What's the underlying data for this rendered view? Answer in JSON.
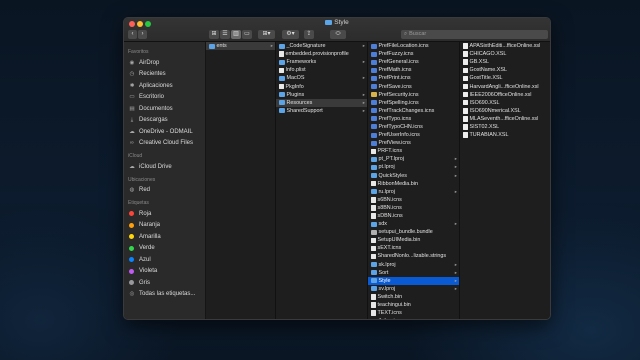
{
  "window": {
    "title": "Style"
  },
  "toolbar": {
    "back_icon": "chevron-left-icon",
    "forward_icon": "chevron-right-icon",
    "search_placeholder": "Buscar"
  },
  "sidebar": {
    "favorites_header": "Favoritos",
    "favorites": [
      {
        "label": "AirDrop",
        "icon": "airdrop-icon"
      },
      {
        "label": "Recientes",
        "icon": "clock-icon"
      },
      {
        "label": "Aplicaciones",
        "icon": "applications-icon"
      },
      {
        "label": "Escritorio",
        "icon": "desktop-icon"
      },
      {
        "label": "Documentos",
        "icon": "document-icon"
      },
      {
        "label": "Descargas",
        "icon": "download-icon"
      },
      {
        "label": "OneDrive - ODMAIL",
        "icon": "cloud-icon"
      },
      {
        "label": "Creative Cloud Files",
        "icon": "creative-cloud-icon"
      }
    ],
    "icloud_header": "iCloud",
    "icloud": [
      {
        "label": "iCloud Drive",
        "icon": "cloud-icon"
      }
    ],
    "locations_header": "Ubicaciones",
    "locations": [
      {
        "label": "Red",
        "icon": "network-icon"
      }
    ],
    "tags_header": "Etiquetas",
    "tags": [
      {
        "label": "Roja",
        "color": "#ff453a"
      },
      {
        "label": "Naranja",
        "color": "#ff9f0a"
      },
      {
        "label": "Amarilla",
        "color": "#ffd60a"
      },
      {
        "label": "Verde",
        "color": "#32d74b"
      },
      {
        "label": "Azul",
        "color": "#0a84ff"
      },
      {
        "label": "Violeta",
        "color": "#bf5af2"
      },
      {
        "label": "Gris",
        "color": "#98989d"
      },
      {
        "label": "Todas las etiquetas...",
        "color": ""
      }
    ]
  },
  "columns": {
    "col1": [
      {
        "label": "ents",
        "kind": "folder",
        "selected": "hl",
        "chevron": true
      }
    ],
    "col2": [
      {
        "label": "_CodeSignature",
        "kind": "folder",
        "chevron": true
      },
      {
        "label": "embedded.provisionprofile",
        "kind": "file"
      },
      {
        "label": "Frameworks",
        "kind": "folder",
        "chevron": true
      },
      {
        "label": "Info.plist",
        "kind": "file"
      },
      {
        "label": "MacOS",
        "kind": "folder",
        "chevron": true
      },
      {
        "label": "PkgInfo",
        "kind": "file"
      },
      {
        "label": "Plugins",
        "kind": "folder",
        "chevron": true
      },
      {
        "label": "Resources",
        "kind": "folder",
        "selected": "hl",
        "chevron": true
      },
      {
        "label": "SharedSupport",
        "kind": "folder",
        "chevron": true
      }
    ],
    "col3": [
      {
        "label": "PrefFileLocation.icns",
        "kind": "icns"
      },
      {
        "label": "PrefFuzzy.icns",
        "kind": "icns"
      },
      {
        "label": "PrefGeneral.icns",
        "kind": "icns"
      },
      {
        "label": "PrefMath.icns",
        "kind": "icns"
      },
      {
        "label": "PrefPrint.icns",
        "kind": "icns"
      },
      {
        "label": "PrefSave.icns",
        "kind": "icns"
      },
      {
        "label": "PrefSecurity.icns",
        "kind": "lock"
      },
      {
        "label": "PrefSpelling.icns",
        "kind": "icns"
      },
      {
        "label": "PrefTrackChanges.icns",
        "kind": "icns"
      },
      {
        "label": "PrefTypo.icns",
        "kind": "icns"
      },
      {
        "label": "PrefTypoCHN.icns",
        "kind": "icns"
      },
      {
        "label": "PrefUserInfo.icns",
        "kind": "icns"
      },
      {
        "label": "PrefView.icns",
        "kind": "icns"
      },
      {
        "label": "PRFT.icns",
        "kind": "file"
      },
      {
        "label": "pt_PT.lproj",
        "kind": "folder",
        "chevron": true
      },
      {
        "label": "pt.lproj",
        "kind": "folder",
        "chevron": true
      },
      {
        "label": "QuickStyles",
        "kind": "folder",
        "chevron": true
      },
      {
        "label": "RibbonMedia.bin",
        "kind": "file"
      },
      {
        "label": "ru.lproj",
        "kind": "folder",
        "chevron": true
      },
      {
        "label": "s6BN.icns",
        "kind": "file"
      },
      {
        "label": "s8BN.icns",
        "kind": "file"
      },
      {
        "label": "sDBN.icns",
        "kind": "file"
      },
      {
        "label": "sdx",
        "kind": "folder",
        "chevron": true
      },
      {
        "label": "setupui_bundle.bundle",
        "kind": "bundle"
      },
      {
        "label": "SetupUIMedia.bin",
        "kind": "file"
      },
      {
        "label": "sEXT.icns",
        "kind": "file"
      },
      {
        "label": "SharedNonlo...lizable.strings",
        "kind": "file"
      },
      {
        "label": "sk.lproj",
        "kind": "folder",
        "chevron": true
      },
      {
        "label": "Sort",
        "kind": "folder",
        "chevron": true
      },
      {
        "label": "Style",
        "kind": "folder",
        "selected": "sel",
        "chevron": true
      },
      {
        "label": "sv.lproj",
        "kind": "folder",
        "chevron": true
      },
      {
        "label": "Switch.bin",
        "kind": "file"
      },
      {
        "label": "teachingui.bin",
        "kind": "file"
      },
      {
        "label": "TEXT.icns",
        "kind": "file"
      },
      {
        "label": "th.lproj",
        "kind": "folder",
        "chevron": true
      }
    ],
    "col4": [
      {
        "label": "APASixthEditi...fficeOnline.xsl",
        "kind": "xsl"
      },
      {
        "label": "CHICAGO.XSL",
        "kind": "xsl"
      },
      {
        "label": "GB.XSL",
        "kind": "xsl"
      },
      {
        "label": "GostName.XSL",
        "kind": "xsl"
      },
      {
        "label": "GostTitle.XSL",
        "kind": "xsl"
      },
      {
        "label": "HarvardAngli...fficeOnline.xsl",
        "kind": "xsl"
      },
      {
        "label": "IEEE2006OfficeOnline.xsl",
        "kind": "xsl"
      },
      {
        "label": "ISO690.XSL",
        "kind": "xsl"
      },
      {
        "label": "ISO690Nmerical.XSL",
        "kind": "xsl"
      },
      {
        "label": "MLASeventh...fficeOnline.xsl",
        "kind": "xsl"
      },
      {
        "label": "SIST02.XSL",
        "kind": "xsl"
      },
      {
        "label": "TURABIAN.XSL",
        "kind": "xsl"
      }
    ]
  }
}
